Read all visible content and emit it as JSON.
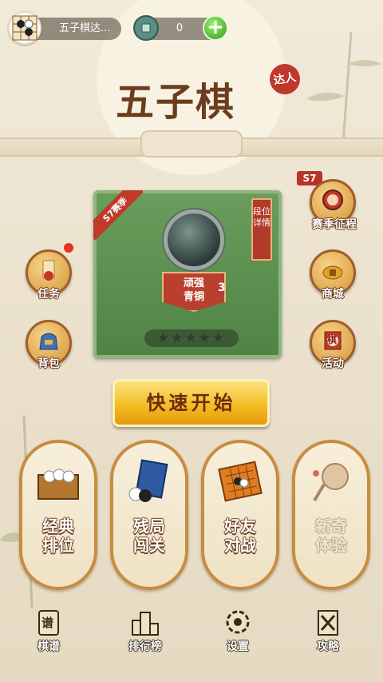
{
  "header": {
    "player_name": "五子棋达...",
    "coins": "0",
    "add_coins_symbol": "+"
  },
  "title": {
    "main": "五子棋",
    "seal": "达人"
  },
  "rank": {
    "season_tag": "S7赛季",
    "detail_label": "段位详情",
    "rank_name_line1": "顽强",
    "rank_name_line2": "青铜",
    "rank_level": "3",
    "stars_filled": 0,
    "stars_total": 5,
    "stars_text": "★★★★★"
  },
  "side_buttons": {
    "tasks": "任务",
    "bag": "背包",
    "season_journey": "赛季征程",
    "season_badge": "S7",
    "shop": "商城",
    "activity": "活动",
    "activity_chess_char": "棋"
  },
  "quick_start": "快速开始",
  "modes": [
    {
      "line1": "经典",
      "line2": "排位"
    },
    {
      "line1": "残局",
      "line2": "闯关"
    },
    {
      "line1": "好友",
      "line2": "对战"
    },
    {
      "line1": "新奇",
      "line2": "体验"
    }
  ],
  "nav": {
    "records": "棋谱",
    "records_icon_char": "谱",
    "leaderboard": "排行榜",
    "settings": "设置",
    "guide": "攻略"
  },
  "colors": {
    "card_green": "#5a8f4d",
    "accent_gold": "#f2b91e",
    "accent_red": "#c0392b"
  }
}
